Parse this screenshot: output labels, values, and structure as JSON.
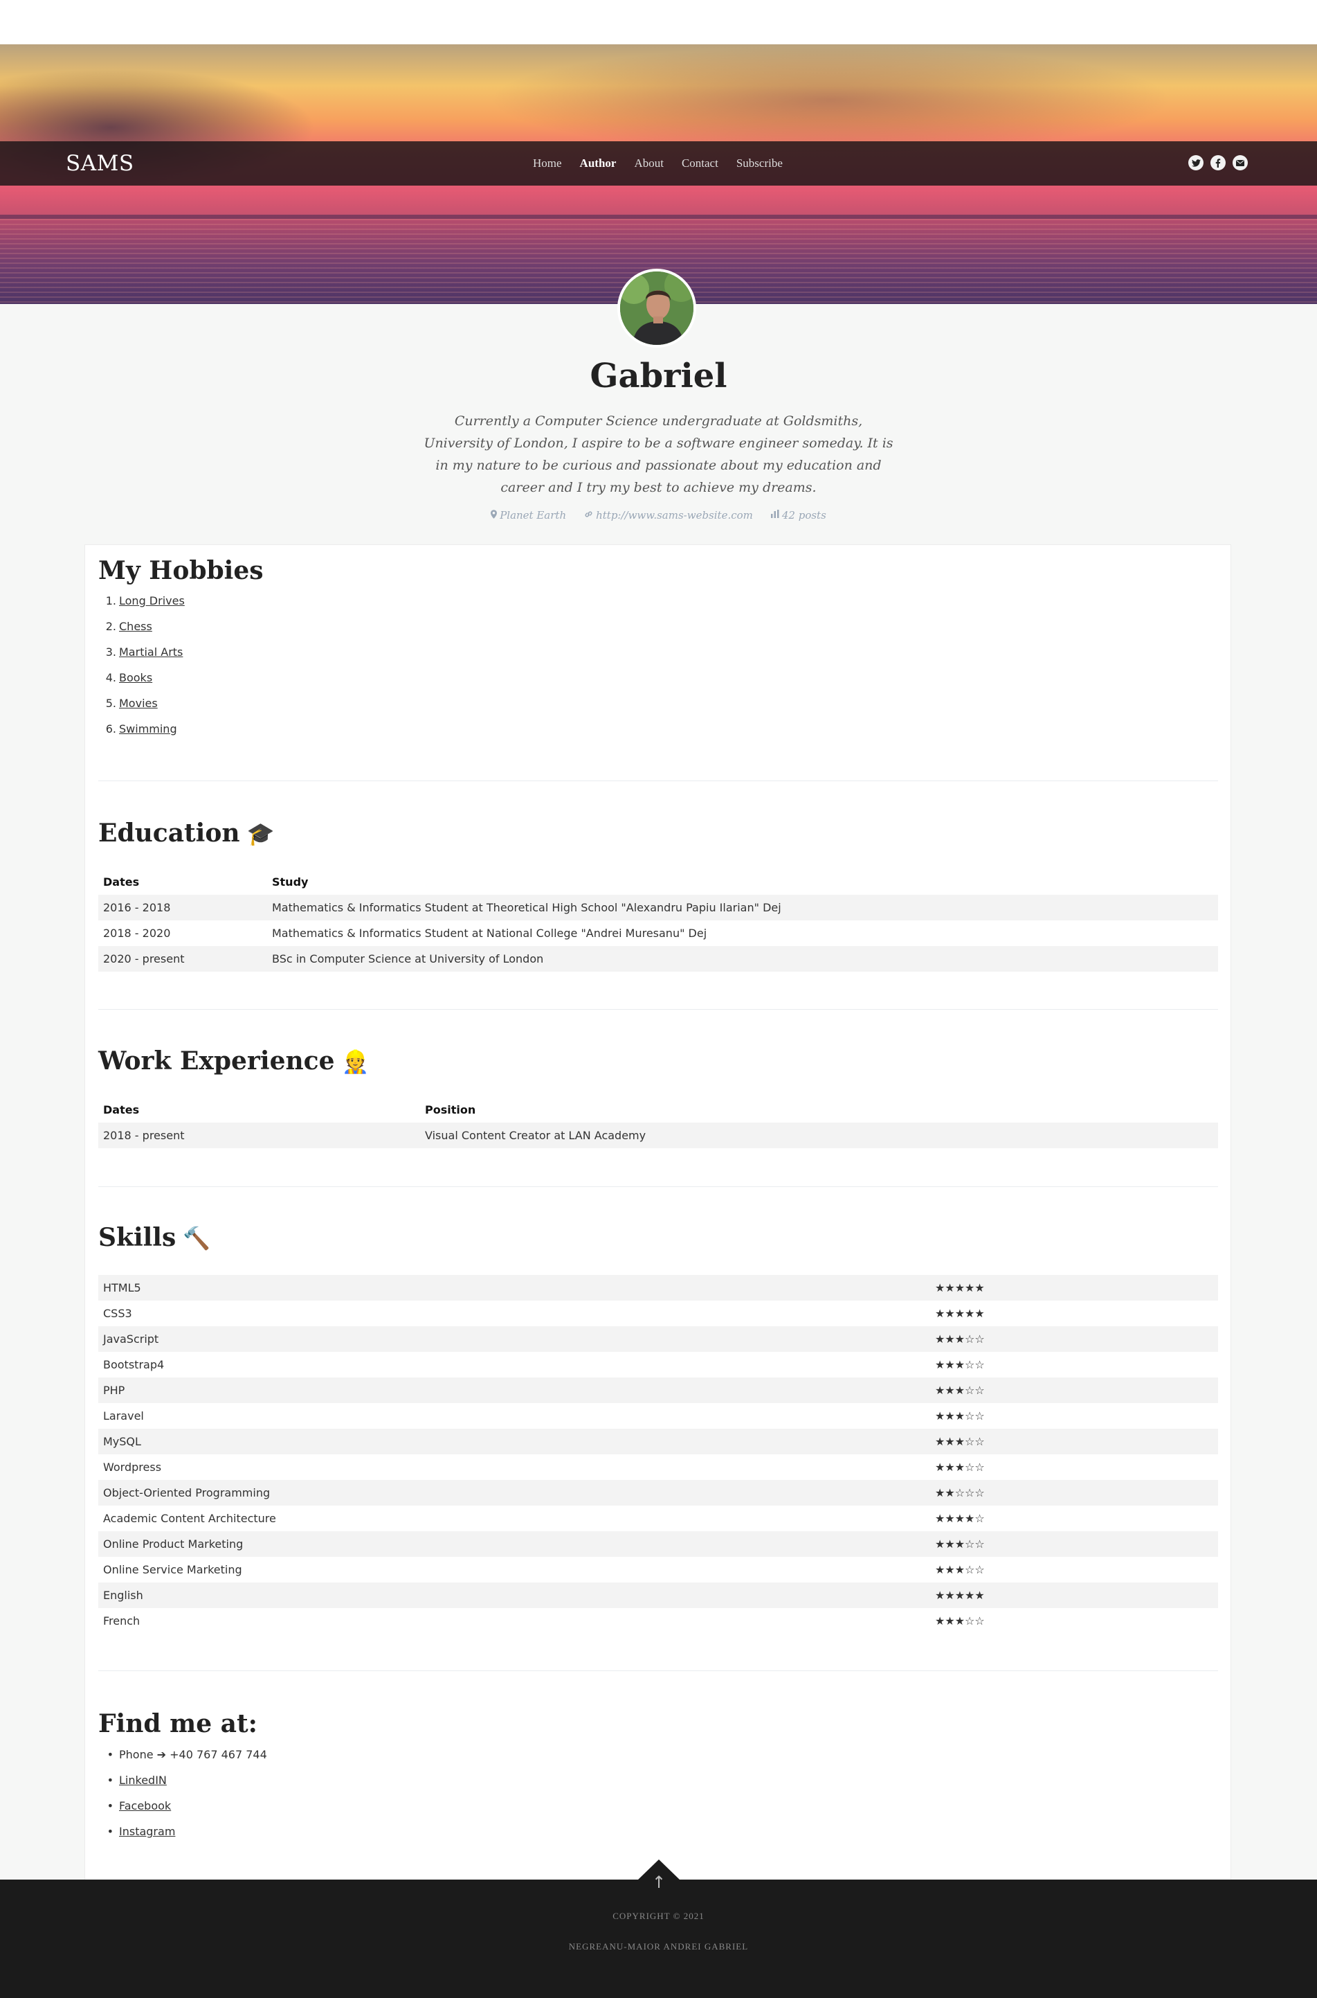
{
  "brand": "SAMS",
  "nav": {
    "links": [
      "Home",
      "Author",
      "About",
      "Contact",
      "Subscribe"
    ],
    "active": "Author"
  },
  "social_icons": [
    "twitter-icon",
    "facebook-icon",
    "email-icon"
  ],
  "author": {
    "name": "Gabriel",
    "bio": "Currently a Computer Science undergraduate at Goldsmiths, University of London, I aspire to be a software engineer someday. It is in my nature to be curious and passionate about my education and career and I try my best to achieve my dreams.",
    "location": "Planet Earth",
    "website": "http://www.sams-website.com",
    "posts": "42 posts"
  },
  "hobbies": {
    "title": "My Hobbies",
    "items": [
      "Long Drives",
      "Chess",
      "Martial Arts",
      "Books",
      "Movies",
      "Swimming"
    ]
  },
  "education": {
    "title": "Education",
    "emoji": "🎓",
    "headers": [
      "Dates",
      "Study"
    ],
    "rows": [
      [
        "2016 - 2018",
        "Mathematics & Informatics Student at Theoretical High School \"Alexandru Papiu Ilarian\" Dej"
      ],
      [
        "2018 - 2020",
        "Mathematics & Informatics Student at National College \"Andrei Muresanu\" Dej"
      ],
      [
        "2020 - present",
        "BSc in Computer Science at University of London"
      ]
    ]
  },
  "work": {
    "title": "Work Experience",
    "emoji": "👷",
    "headers": [
      "Dates",
      "Position"
    ],
    "rows": [
      [
        "2018 - present",
        "Visual Content Creator at LAN Academy"
      ]
    ]
  },
  "skills": {
    "title": "Skills",
    "emoji": "🔨",
    "rows": [
      [
        "HTML5",
        "★★★★★"
      ],
      [
        "CSS3",
        "★★★★★"
      ],
      [
        "JavaScript",
        "★★★☆☆"
      ],
      [
        "Bootstrap4",
        "★★★☆☆"
      ],
      [
        "PHP",
        "★★★☆☆"
      ],
      [
        "Laravel",
        "★★★☆☆"
      ],
      [
        "MySQL",
        "★★★☆☆"
      ],
      [
        "Wordpress",
        "★★★☆☆"
      ],
      [
        "Object-Oriented Programming",
        "★★☆☆☆"
      ],
      [
        "Academic Content Architecture",
        "★★★★☆"
      ],
      [
        "Online Product Marketing",
        "★★★☆☆"
      ],
      [
        "Online Service Marketing",
        "★★★☆☆"
      ],
      [
        "English",
        "★★★★★"
      ],
      [
        "French",
        "★★★☆☆"
      ]
    ]
  },
  "find": {
    "title": "Find me at:",
    "phone": "Phone ➔ +40 767 467 744",
    "links": [
      "LinkedIN",
      "Facebook",
      "Instagram"
    ]
  },
  "footer": {
    "copyright": "COPYRIGHT © 2021",
    "author": "NEGREANU-MAIOR ANDREI GABRIEL",
    "to_top": "↑"
  }
}
